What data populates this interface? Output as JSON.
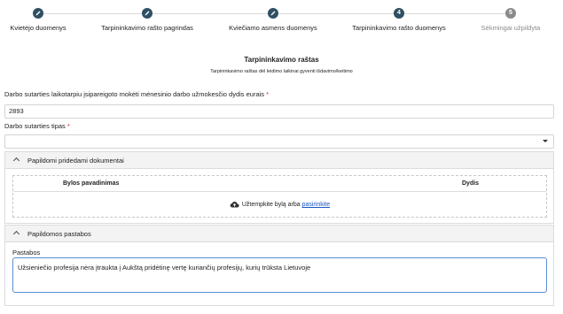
{
  "stepper": {
    "steps": [
      {
        "number": "",
        "label": "Kvietėjo duomenys",
        "state": "done"
      },
      {
        "number": "",
        "label": "Tarpininkavimo rašto pagrindas",
        "state": "done"
      },
      {
        "number": "",
        "label": "Kviečiamo asmens duomenys",
        "state": "done"
      },
      {
        "number": "4",
        "label": "Tarpininkavimo rašto duomenys",
        "state": "active"
      },
      {
        "number": "5",
        "label": "Sėkmingai užpildyta",
        "state": "pending"
      }
    ]
  },
  "header": {
    "title": "Tarpininkavimo raštas",
    "subtitle": "Tarpininkavimo raštas dėl leidimo laikinai gyventi išdavimo/keitimo"
  },
  "form": {
    "salary": {
      "label": "Darbo sutarties laikotarpiu įsipareigoto mokėti mėnesinio darbo užmokesčio dydis eurais",
      "required_mark": "*",
      "value": "2893"
    },
    "contract_type": {
      "label": "Darbo sutarties tipas",
      "required_mark": "*",
      "value": ""
    }
  },
  "documents_panel": {
    "title": "Papildomi pridedami dokumentai",
    "columns": [
      "Bylos pavadinimas",
      "Dydis"
    ],
    "upload_text": "Užtempkite bylą arba",
    "upload_link": "pasirinkite"
  },
  "notes_panel": {
    "title": "Papildomos pastabos",
    "field_label": "Pastabos",
    "field_value": "Užsieniečio profesija nėra įtraukta į Aukštą pridėtinę vertę kuriančių profesijų, kurių trūksta Lietuvoje"
  },
  "colors": {
    "step_active": "#2f4f63",
    "step_pending": "#8a8a8a",
    "required": "#d9262b",
    "link": "#1a56c4",
    "focus_border": "#5b8ed6"
  }
}
